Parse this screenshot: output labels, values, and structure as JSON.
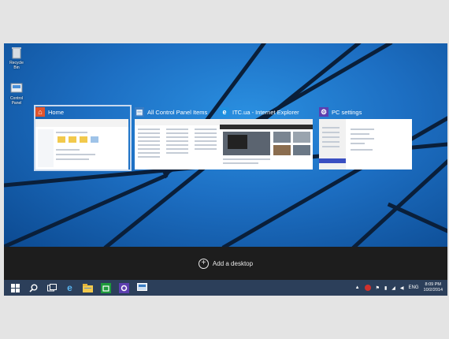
{
  "desktop_icons": [
    {
      "name": "recycle-bin-icon",
      "label": "Recycle Bin"
    },
    {
      "name": "control-panel-icon",
      "label": "Control Panel"
    }
  ],
  "windows": [
    {
      "title": "Home",
      "icon": "folder-home-icon",
      "icon_color": "#e0542c",
      "active": true
    },
    {
      "title": "All Control Panel Items",
      "icon": "control-panel-icon",
      "icon_color": "#3b7dc4",
      "active": false
    },
    {
      "title": "ITC.ua - Internet Explorer",
      "icon": "internet-explorer-icon",
      "icon_color": "#1e90e0",
      "active": false
    },
    {
      "title": "PC settings",
      "icon": "gear-icon",
      "icon_color": "#5d3fb0",
      "active": false
    }
  ],
  "add_desktop_label": "Add a desktop",
  "taskbar": {
    "items": [
      "start-icon",
      "search-icon",
      "task-view-icon",
      "internet-explorer-icon",
      "file-explorer-icon",
      "store-icon",
      "settings-icon",
      "control-panel-icon"
    ]
  },
  "tray": {
    "language": "ENG",
    "time": "8:09 PM",
    "date": "10/2/2014"
  },
  "colors": {
    "accent": "#1d6fc3",
    "taskbar": "#2c3f5a",
    "addbar": "#1d1d1d"
  }
}
